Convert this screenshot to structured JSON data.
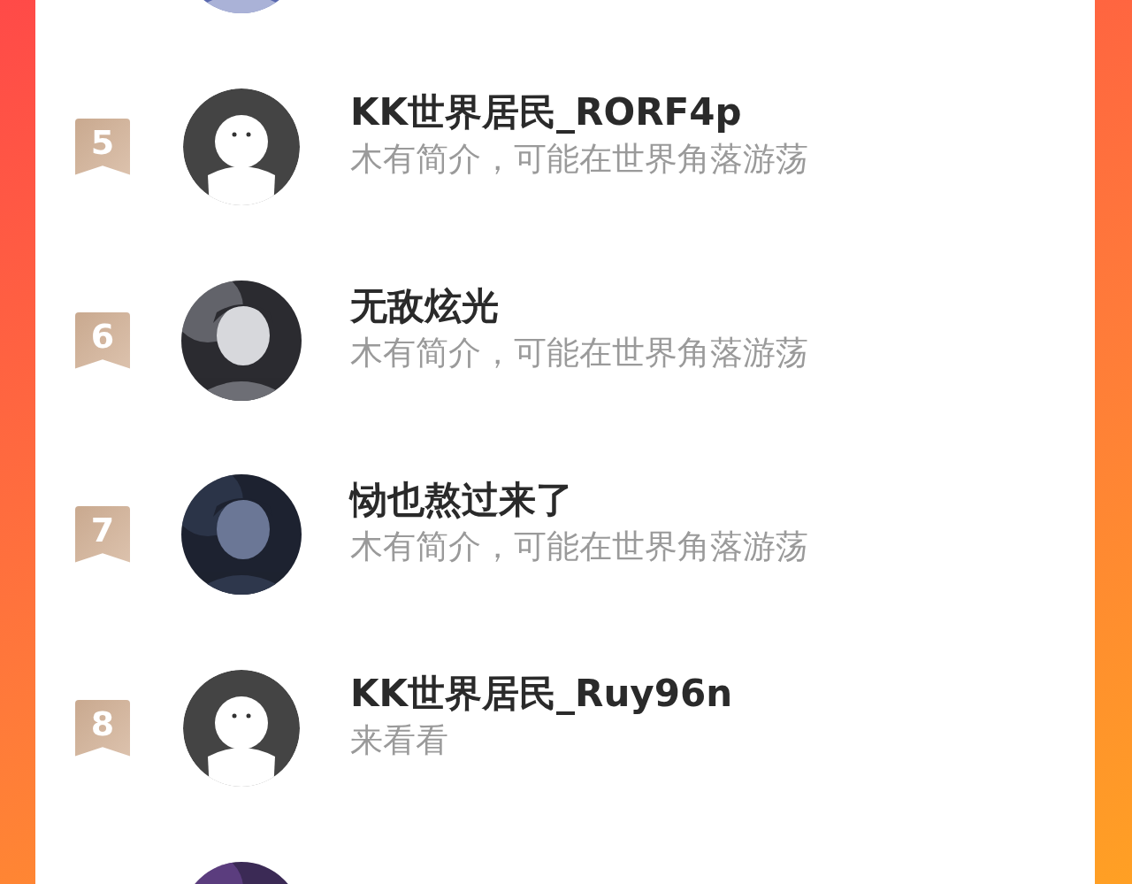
{
  "rows": [
    {
      "avatar": {
        "kind": "picture"
      }
    },
    {
      "rank": "5",
      "name": "KK世界居民_RORF4p",
      "bio": "木有简介，可能在世界角落游荡",
      "avatar": {
        "kind": "default"
      }
    },
    {
      "rank": "6",
      "name": "无敌炫光",
      "bio": "木有简介，可能在世界角落游荡",
      "avatar": {
        "kind": "picture"
      }
    },
    {
      "rank": "7",
      "name": "恸也熬过来了",
      "bio": "木有简介，可能在世界角落游荡",
      "avatar": {
        "kind": "picture"
      }
    },
    {
      "rank": "8",
      "name": "KK世界居民_Ruy96n",
      "bio": "来看看",
      "avatar": {
        "kind": "default"
      }
    },
    {
      "avatar": {
        "kind": "picture"
      }
    }
  ]
}
